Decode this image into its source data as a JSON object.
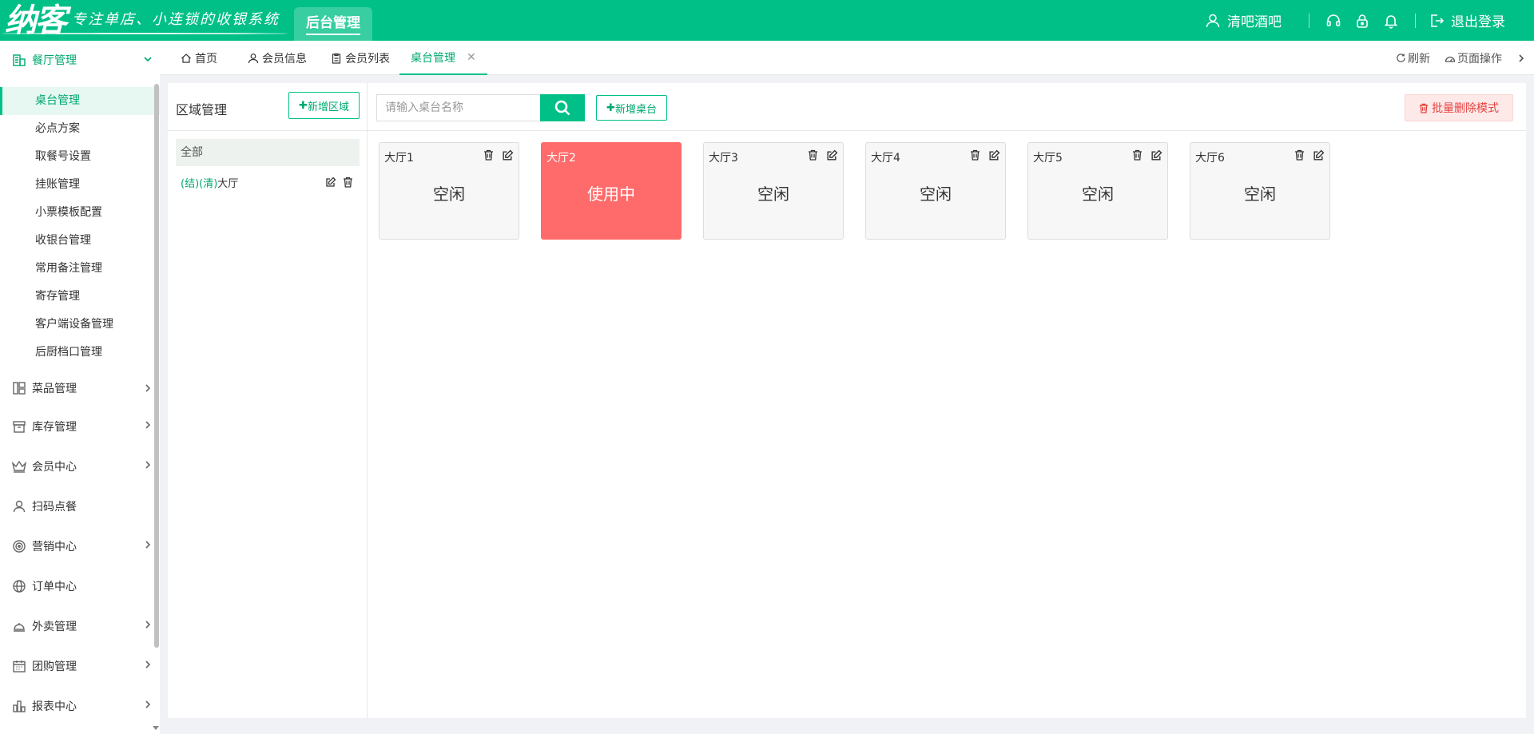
{
  "header": {
    "logo_main": "纳客",
    "logo_slogan": "专注单店、小连锁的收银系统",
    "admin_tab": "后台管理",
    "username": "清吧酒吧",
    "logout": "退出登录"
  },
  "sidebar": {
    "groups": [
      {
        "label": "餐厅管理",
        "icon": "store-icon",
        "expanded": true
      },
      {
        "label": "菜品管理",
        "icon": "layout-icon"
      },
      {
        "label": "库存管理",
        "icon": "box-icon"
      },
      {
        "label": "会员中心",
        "icon": "crown-icon"
      },
      {
        "label": "扫码点餐",
        "icon": "user-icon"
      },
      {
        "label": "营销中心",
        "icon": "target-icon"
      },
      {
        "label": "订单中心",
        "icon": "globe-icon"
      },
      {
        "label": "外卖管理",
        "icon": "bell-dish-icon"
      },
      {
        "label": "团购管理",
        "icon": "calendar-icon"
      },
      {
        "label": "报表中心",
        "icon": "bar-chart-icon"
      }
    ],
    "subitems": [
      "桌台管理",
      "必点方案",
      "取餐号设置",
      "挂账管理",
      "小票模板配置",
      "收银台管理",
      "常用备注管理",
      "寄存管理",
      "客户端设备管理",
      "后厨档口管理"
    ]
  },
  "tabs": {
    "items": [
      "首页",
      "会员信息",
      "会员列表",
      "桌台管理"
    ],
    "active": "桌台管理",
    "refresh": "刷新",
    "page_ops": "页面操作"
  },
  "area": {
    "title": "区域管理",
    "add_button": "新增区域",
    "all": "全部",
    "items": [
      {
        "prefix": "(结)(清)",
        "name": "大厅"
      }
    ]
  },
  "main": {
    "search_placeholder": "请输入桌台名称",
    "add_table_button": "新增桌台",
    "batch_delete_button": "批量删除模式"
  },
  "tables": [
    {
      "name": "大厅1",
      "status": "空闲",
      "busy": false
    },
    {
      "name": "大厅2",
      "status": "使用中",
      "busy": true
    },
    {
      "name": "大厅3",
      "status": "空闲",
      "busy": false
    },
    {
      "name": "大厅4",
      "status": "空闲",
      "busy": false
    },
    {
      "name": "大厅5",
      "status": "空闲",
      "busy": false
    },
    {
      "name": "大厅6",
      "status": "空闲",
      "busy": false
    }
  ],
  "colors": {
    "brand": "#00c087",
    "busy": "#ff6b6b",
    "danger": "#e64340"
  }
}
